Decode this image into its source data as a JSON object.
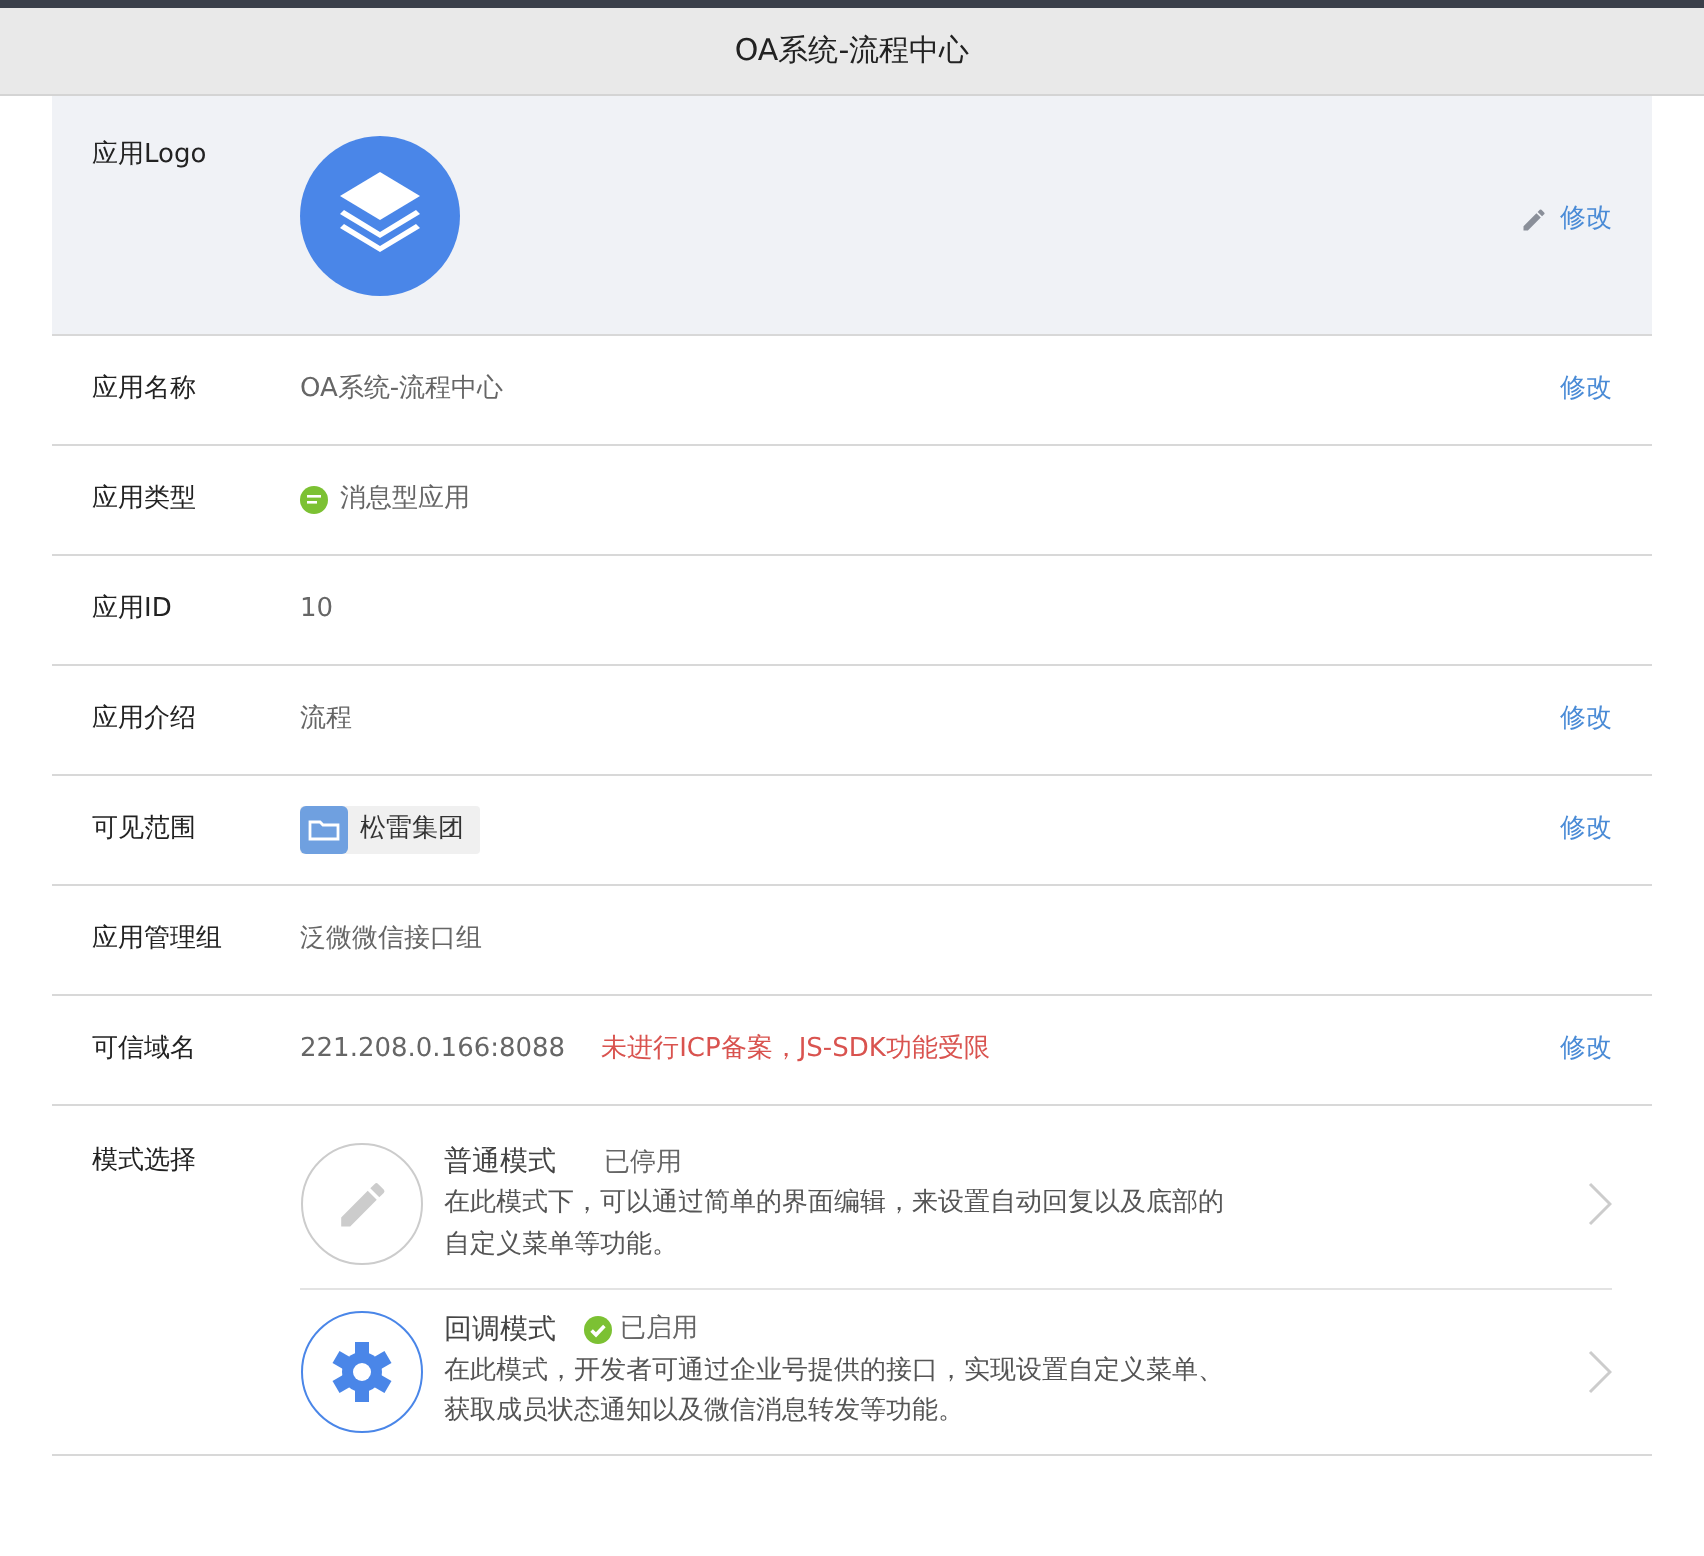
{
  "header": {
    "title": "OA系统-流程中心"
  },
  "rows": [
    {
      "kind": "logo",
      "label": "应用Logo",
      "action": "修改"
    },
    {
      "kind": "text",
      "label": "应用名称",
      "value": "OA系统-流程中心",
      "action": "修改"
    },
    {
      "kind": "type",
      "label": "应用类型",
      "value": "消息型应用"
    },
    {
      "kind": "text",
      "label": "应用ID",
      "value": "10"
    },
    {
      "kind": "text",
      "label": "应用介绍",
      "value": "流程",
      "action": "修改"
    },
    {
      "kind": "tag",
      "label": "可见范围",
      "value": "松雷集团",
      "action": "修改"
    },
    {
      "kind": "text",
      "label": "应用管理组",
      "value": "泛微微信接口组"
    },
    {
      "kind": "domain",
      "label": "可信域名",
      "value": "221.208.0.166:8088",
      "warning": "未进行ICP备案，JS-SDK功能受限",
      "action": "修改"
    },
    {
      "kind": "modes",
      "label": "模式选择",
      "modes": [
        {
          "kind": "edit",
          "name": "普通模式",
          "status": "已停用",
          "enabled": false,
          "description": "在此模式下，可以通过简单的界面编辑，来设置自动回复以及底部的自定义菜单等功能。"
        },
        {
          "kind": "callback",
          "name": "回调模式",
          "status": "已启用",
          "enabled": true,
          "description": "在此模式，开发者可通过企业号提供的接口，实现设置自定义菜单、获取成员状态通知以及微信消息转发等功能。"
        }
      ]
    }
  ]
}
